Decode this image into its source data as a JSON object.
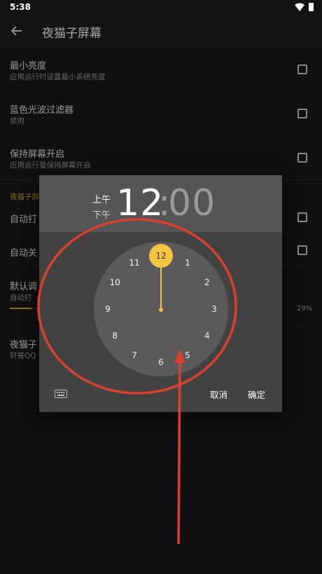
{
  "status_bar": {
    "time": "5:38"
  },
  "app_bar": {
    "title": "夜猫子屏幕"
  },
  "settings": [
    {
      "title": "最小亮度",
      "subtitle": "应用运行时设置最小系统亮度"
    },
    {
      "title": "蓝色光波过滤器",
      "subtitle": "禁用"
    },
    {
      "title": "保持屏幕开启",
      "subtitle": "应用运行是保持屏幕开启"
    },
    {
      "section": "夜猫子屏"
    },
    {
      "title": "自动打"
    },
    {
      "title": "自动关"
    },
    {
      "title": "默认调",
      "subtitle": "自动打",
      "percent": "29%",
      "level": 0.08
    },
    {
      "title": "夜猫子",
      "subtitle": "轩哥QQ"
    }
  ],
  "time_picker": {
    "am_label": "上午",
    "pm_label": "下午",
    "hour": "12",
    "colon": ":",
    "minute": "00",
    "clock_numbers": [
      "12",
      "1",
      "2",
      "3",
      "4",
      "5",
      "6",
      "7",
      "8",
      "9",
      "10",
      "11"
    ],
    "selected_hour": "12",
    "cancel_label": "取消",
    "ok_label": "确定",
    "accent_color": "#f5c542"
  },
  "annotation": {
    "color": "#d9412e"
  }
}
